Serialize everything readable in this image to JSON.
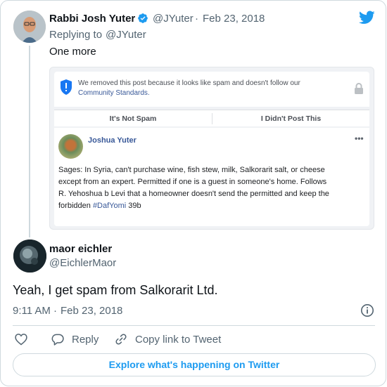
{
  "parent_tweet": {
    "author_name": "Rabbi Josh Yuter",
    "handle": "@JYuter",
    "separator": "·",
    "date": "Feb 23, 2018",
    "replying_prefix": "Replying to",
    "replying_to": "@JYuter",
    "text": "One more",
    "embedded_screenshot": {
      "notice_line1": "We removed this post because it looks like spam and doesn't follow our",
      "notice_link": "Community Standards.",
      "button_not_spam": "It's Not Spam",
      "button_didnt_post": "I Didn't Post This",
      "post_author": "Joshua Yuter",
      "more": "•••",
      "post_line1": "Sages: In Syria, can't purchase wine, fish stew, milk, Salkorarit salt, or cheese",
      "post_line2": "except from an expert. Permitted if one is a guest in someone's home. Follows",
      "post_line3": "R. Yehoshua b Levi that a homeowner doesn't send the permitted and keep the",
      "post_line4_prefix": "forbidden",
      "post_hashtag": "#DafYomi",
      "post_line4_suffix": "39b"
    }
  },
  "reply_tweet": {
    "author_name": "maor eichler",
    "handle": "@EichlerMaor",
    "text": "Yeah, I get spam from Salkorarit Ltd.",
    "time": "9:11 AM",
    "separator": "·",
    "date": "Feb 23, 2018"
  },
  "actions": {
    "reply_label": "Reply",
    "copy_link_label": "Copy link to Tweet"
  },
  "explore_button": "Explore what's happening on Twitter",
  "colors": {
    "twitter_blue": "#1d9bf0",
    "text_primary": "#0f1419",
    "text_muted": "#536471",
    "facebook_blue": "#385898"
  },
  "icons": {
    "verified": "verified-badge-icon",
    "brand": "twitter-bird-icon",
    "info": "info-icon",
    "like": "heart-icon",
    "reply": "reply-bubble-icon",
    "copy_link": "link-icon",
    "shield": "shield-alert-icon",
    "lock": "lock-icon"
  }
}
